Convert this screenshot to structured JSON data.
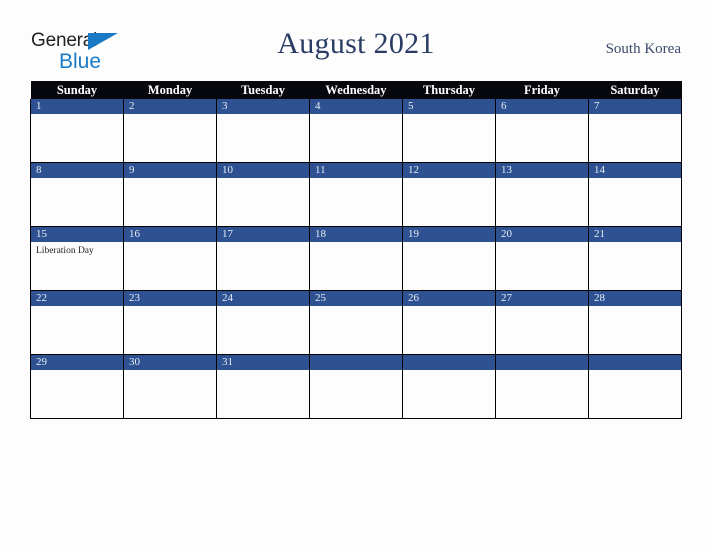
{
  "brand": {
    "name_part1": "General",
    "name_part2": "Blue",
    "triangle_color": "#1a7ac4",
    "text_color": "#222222",
    "blue_color": "#1a7ac4"
  },
  "header": {
    "title": "August 2021",
    "locale": "South Korea",
    "title_color": "#2a3c64",
    "locale_color": "#3a4a6b"
  },
  "calendar": {
    "weekday_headers": [
      "Sunday",
      "Monday",
      "Tuesday",
      "Wednesday",
      "Thursday",
      "Friday",
      "Saturday"
    ],
    "header_bg": "#07080d",
    "header_text_color": "#ffffff",
    "daynum_bg": "#2d5191",
    "daynum_text_color": "#e8eef8",
    "cell_bg": "#fdfdfd",
    "border_color": "#000000",
    "weeks": [
      [
        {
          "day": "1",
          "events": []
        },
        {
          "day": "2",
          "events": []
        },
        {
          "day": "3",
          "events": []
        },
        {
          "day": "4",
          "events": []
        },
        {
          "day": "5",
          "events": []
        },
        {
          "day": "6",
          "events": []
        },
        {
          "day": "7",
          "events": []
        }
      ],
      [
        {
          "day": "8",
          "events": []
        },
        {
          "day": "9",
          "events": []
        },
        {
          "day": "10",
          "events": []
        },
        {
          "day": "11",
          "events": []
        },
        {
          "day": "12",
          "events": []
        },
        {
          "day": "13",
          "events": []
        },
        {
          "day": "14",
          "events": []
        }
      ],
      [
        {
          "day": "15",
          "events": [
            "Liberation Day"
          ]
        },
        {
          "day": "16",
          "events": []
        },
        {
          "day": "17",
          "events": []
        },
        {
          "day": "18",
          "events": []
        },
        {
          "day": "19",
          "events": []
        },
        {
          "day": "20",
          "events": []
        },
        {
          "day": "21",
          "events": []
        }
      ],
      [
        {
          "day": "22",
          "events": []
        },
        {
          "day": "23",
          "events": []
        },
        {
          "day": "24",
          "events": []
        },
        {
          "day": "25",
          "events": []
        },
        {
          "day": "26",
          "events": []
        },
        {
          "day": "27",
          "events": []
        },
        {
          "day": "28",
          "events": []
        }
      ],
      [
        {
          "day": "29",
          "events": []
        },
        {
          "day": "30",
          "events": []
        },
        {
          "day": "31",
          "events": []
        },
        {
          "day": "",
          "events": []
        },
        {
          "day": "",
          "events": []
        },
        {
          "day": "",
          "events": []
        },
        {
          "day": "",
          "events": []
        }
      ]
    ]
  }
}
